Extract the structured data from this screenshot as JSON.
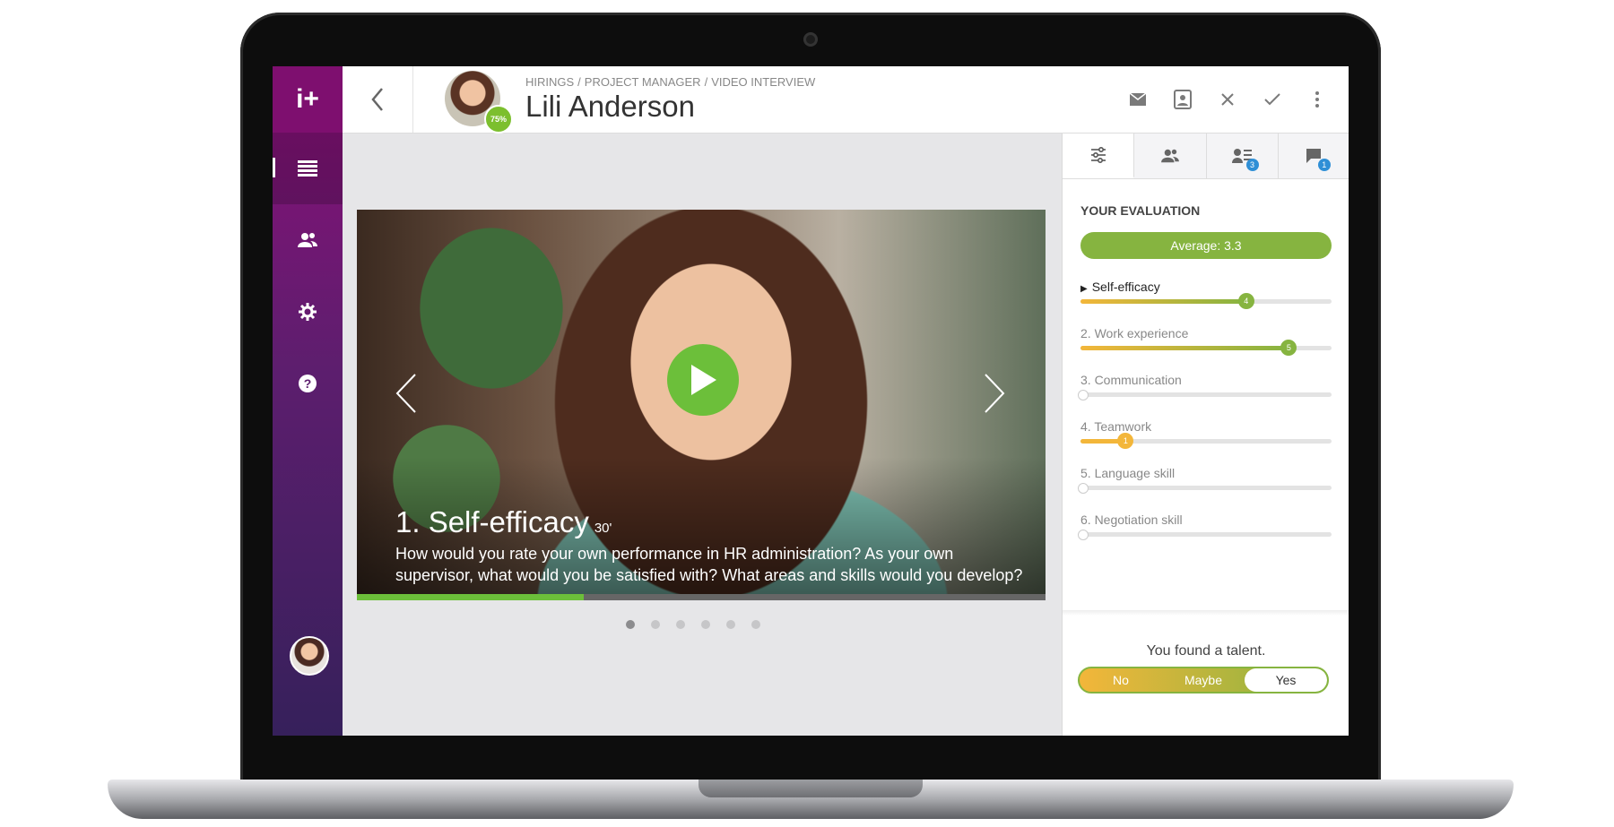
{
  "app": {
    "logo": "i+"
  },
  "header": {
    "breadcrumb": [
      "HIRINGS",
      "PROJECT MANAGER",
      "VIDEO INTERVIEW"
    ],
    "breadcrumb_sep": "/",
    "candidate_name": "Lili Anderson",
    "candidate_score": "75%",
    "actions": [
      "envelope-icon",
      "document-icon",
      "close-icon",
      "check-icon",
      "more-icon"
    ]
  },
  "sidebar": {
    "items": [
      "list-icon",
      "people-icon",
      "settings-icon",
      "help-icon"
    ],
    "active_index": 0
  },
  "video": {
    "question_title": "1. Self-efficacy",
    "question_duration": "30'",
    "question_text": "How would you rate your own performance in HR administration? As your own supervisor, what would you be satisfied with? What areas and skills would you develop?",
    "progress": 0.33,
    "slide_count": 6,
    "active_slide": 0
  },
  "panel": {
    "tabs": [
      {
        "icon": "sliders-icon",
        "badge": null
      },
      {
        "icon": "team-icon",
        "badge": null
      },
      {
        "icon": "candidate-list-icon",
        "badge": "3"
      },
      {
        "icon": "comment-icon",
        "badge": "1"
      }
    ],
    "active_tab": 0,
    "eval_title": "YOUR EVALUATION",
    "average_label": "Average: 3.3",
    "criteria": [
      {
        "label": "Self-efficacy",
        "prefix": "▶",
        "score": "4",
        "fraction": 0.66,
        "current": true
      },
      {
        "label": "2. Work experience",
        "prefix": "",
        "score": "5",
        "fraction": 0.83,
        "current": false
      },
      {
        "label": "3. Communication",
        "prefix": "",
        "score": "",
        "fraction": 0,
        "current": false
      },
      {
        "label": "4. Teamwork",
        "prefix": "",
        "score": "1",
        "fraction": 0.18,
        "current": false
      },
      {
        "label": "5. Language skill",
        "prefix": "",
        "score": "",
        "fraction": 0,
        "current": false
      },
      {
        "label": "6. Negotiation skill",
        "prefix": "",
        "score": "",
        "fraction": 0,
        "current": false
      }
    ],
    "talent_text": "You found a talent.",
    "talent_options": [
      "No",
      "Maybe",
      "Yes"
    ],
    "talent_selected": 2
  },
  "colors": {
    "accent_green": "#86b440",
    "accent_orange": "#f3b63a",
    "sidebar_top": "#8a0f78",
    "badge_blue": "#2f8fd6"
  }
}
